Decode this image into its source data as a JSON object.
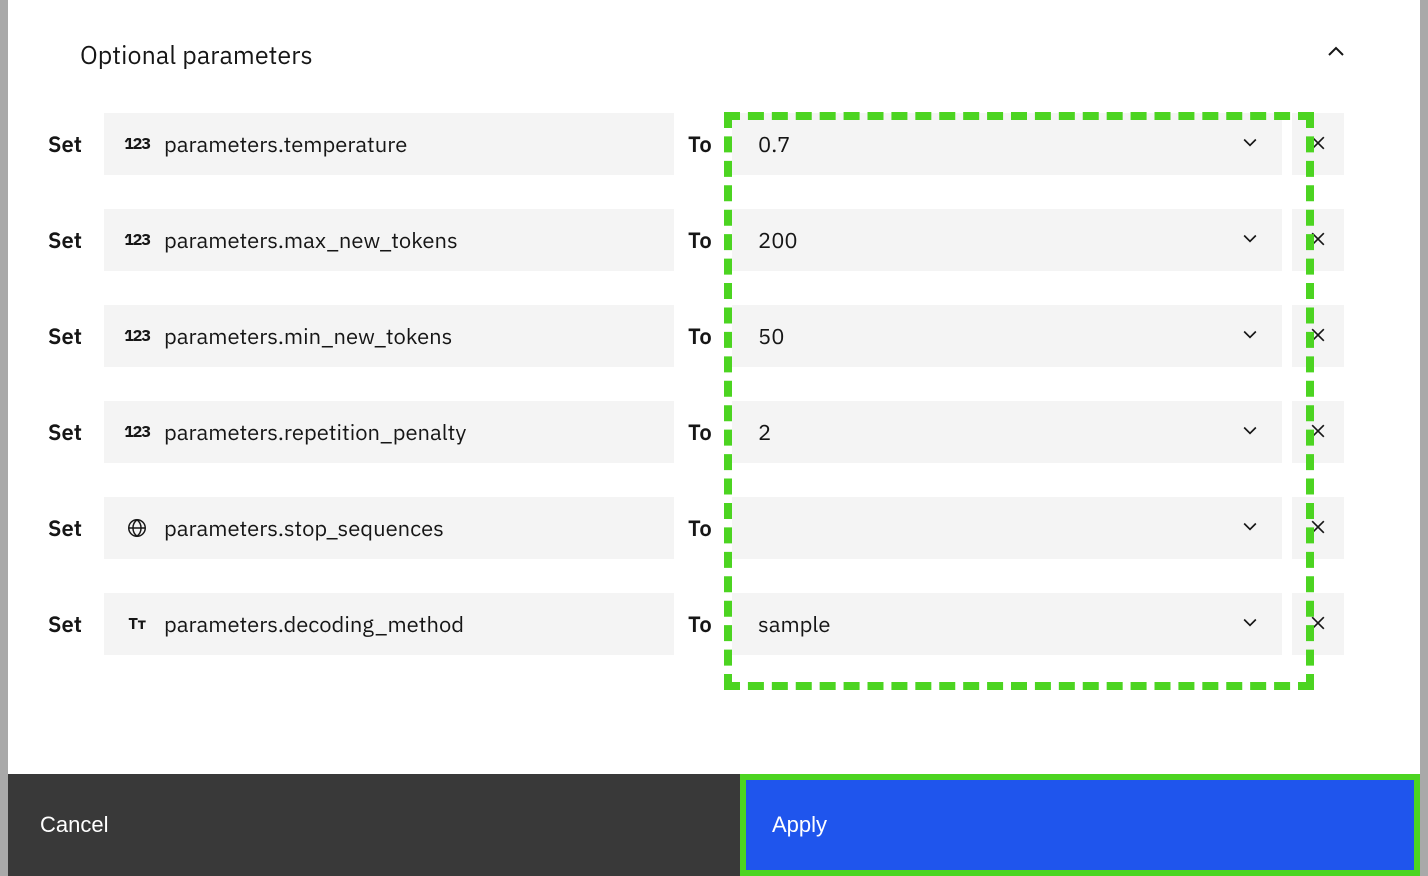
{
  "section": {
    "title": "Optional parameters"
  },
  "labels": {
    "set": "Set",
    "to": "To"
  },
  "rows": [
    {
      "icon": "number",
      "param": "parameters.temperature",
      "value": "0.7"
    },
    {
      "icon": "number",
      "param": "parameters.max_new_tokens",
      "value": "200"
    },
    {
      "icon": "number",
      "param": "parameters.min_new_tokens",
      "value": "50"
    },
    {
      "icon": "number",
      "param": "parameters.repetition_penalty",
      "value": "2"
    },
    {
      "icon": "globe",
      "param": "parameters.stop_sequences",
      "value": ""
    },
    {
      "icon": "text",
      "param": "parameters.decoding_method",
      "value": "sample"
    }
  ],
  "footer": {
    "cancel": "Cancel",
    "apply": "Apply"
  },
  "icon_glyphs": {
    "number": "123",
    "text": "Tт"
  }
}
